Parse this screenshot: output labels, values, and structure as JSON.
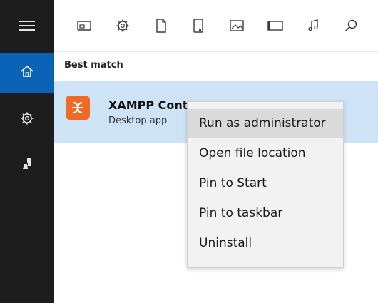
{
  "sidebar": {
    "items": [
      {
        "icon": "hamburger-icon"
      },
      {
        "icon": "home-icon",
        "active": true
      },
      {
        "icon": "gear-icon"
      },
      {
        "icon": "user-icon"
      }
    ]
  },
  "toolbar": {
    "filters": [
      {
        "icon": "apps-icon"
      },
      {
        "icon": "settings-icon"
      },
      {
        "icon": "document-icon"
      },
      {
        "icon": "tablet-icon"
      },
      {
        "icon": "photos-icon"
      },
      {
        "icon": "videos-icon"
      },
      {
        "icon": "music-icon"
      },
      {
        "icon": "search-icon"
      }
    ]
  },
  "results": {
    "section_title": "Best match",
    "best_match": {
      "name": "XAMPP Control Panel",
      "type": "Desktop app"
    }
  },
  "context_menu": {
    "items": [
      {
        "label": "Run as administrator",
        "highlighted": true
      },
      {
        "label": "Open file location"
      },
      {
        "label": "Pin to Start"
      },
      {
        "label": "Pin to taskbar"
      },
      {
        "label": "Uninstall"
      }
    ]
  },
  "colors": {
    "rail_bg": "#1d1d1d",
    "rail_active": "#0a63b6",
    "result_highlight": "#cfe3f6",
    "menu_bg": "#f2f2f2",
    "menu_hover": "#dadada",
    "app_icon_bg": "#f06a26"
  }
}
